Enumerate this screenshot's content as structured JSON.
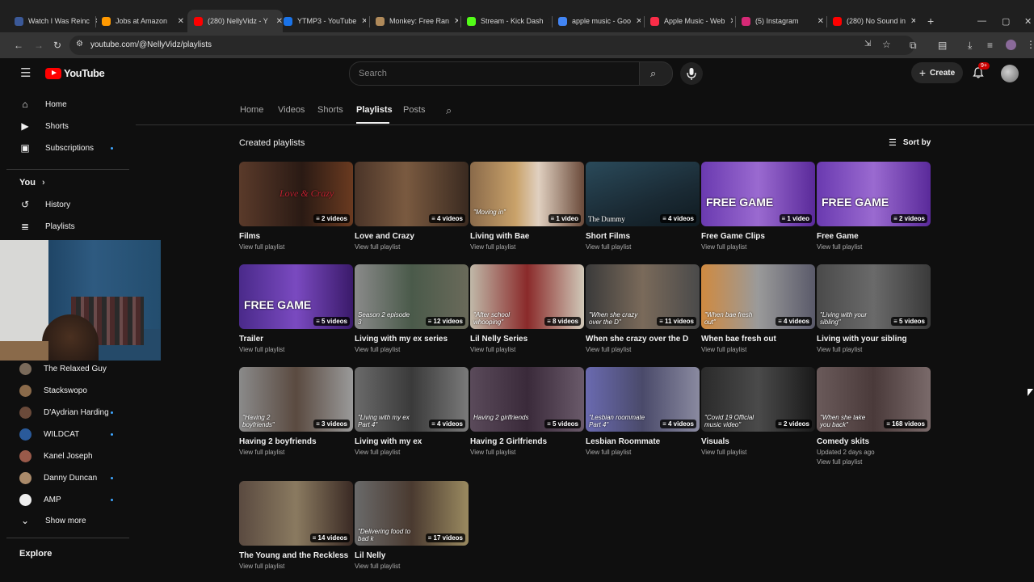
{
  "browser": {
    "tabs": [
      {
        "title": "Watch I Was Reinc",
        "color": "#3b5998"
      },
      {
        "title": "Jobs at Amazon",
        "color": "#ff9900"
      },
      {
        "title": "(280) NellyVidz - Y",
        "color": "#ff0000"
      },
      {
        "title": "YTMP3 - YouTube",
        "color": "#1a73e8"
      },
      {
        "title": "Monkey: Free Ran",
        "color": "#b08a5a"
      },
      {
        "title": "Stream - Kick Dash",
        "color": "#53fc18"
      },
      {
        "title": "apple music - Goo",
        "color": "#4285f4"
      },
      {
        "title": "Apple Music - Web",
        "color": "#fa2d48"
      },
      {
        "title": "(5) Instagram",
        "color": "#d62976"
      },
      {
        "title": "(280) No Sound in",
        "color": "#ff0000"
      }
    ],
    "url": "youtube.com/@NellyVidz/playlists",
    "new_tab": "+"
  },
  "header": {
    "logo_text": "YouTube",
    "search_placeholder": "Search",
    "create_label": "Create",
    "notif_badge": "9+"
  },
  "sidebar": {
    "main": [
      {
        "label": "Home",
        "icon": "home-icon"
      },
      {
        "label": "Shorts",
        "icon": "shorts-icon"
      },
      {
        "label": "Subscriptions",
        "icon": "subscriptions-icon"
      }
    ],
    "you_label": "You",
    "you_items": [
      {
        "label": "History",
        "icon": "history-icon"
      },
      {
        "label": "Playlists",
        "icon": "playlists-icon"
      }
    ],
    "subs": [
      {
        "label": "The Relaxed Guy",
        "color": "#7a6a5a"
      },
      {
        "label": "Stackswopo",
        "color": "#8a6a4a"
      },
      {
        "label": "D'Aydrian Harding",
        "color": "#6a4a3a"
      },
      {
        "label": "WILDCAT",
        "color": "#2a5a9a"
      },
      {
        "label": "Kanel Joseph",
        "color": "#9a5a4a"
      },
      {
        "label": "Danny Duncan",
        "color": "#aa8a6a"
      },
      {
        "label": "AMP",
        "color": "#eeeeee"
      }
    ],
    "show_more": "Show more",
    "explore": "Explore"
  },
  "channel_tabs": [
    "Home",
    "Videos",
    "Shorts",
    "Playlists",
    "Posts"
  ],
  "section_title": "Created playlists",
  "sort_label": "Sort by",
  "playlists": [
    {
      "title": "Films",
      "count": "2 videos",
      "link": "View full playlist",
      "bg": "linear-gradient(90deg,#5a3a2a,#2a1a14 55%,#6a3a20)",
      "caption": "Love & Crazy"
    },
    {
      "title": "Love and Crazy",
      "count": "4 videos",
      "link": "View full playlist",
      "bg": "linear-gradient(90deg,#4a3428,#7a5a40 45%,#3a2a20)",
      "caption": ""
    },
    {
      "title": "Living with Bae",
      "count": "1 video",
      "link": "View full playlist",
      "bg": "linear-gradient(90deg,#8a6a4a,#c9a26a 40%,#e0d0c0 60%,#6a4a3a)",
      "caption": "\"Moving in\""
    },
    {
      "title": "Short Films",
      "count": "4 videos",
      "link": "View full playlist",
      "bg": "linear-gradient(160deg,#2a4a5a,#1a2a34 60%,#0f1a20)",
      "caption": "The Dummy"
    },
    {
      "title": "Free Game Clips",
      "count": "1 video",
      "link": "View full playlist",
      "bg": "linear-gradient(90deg,#6a3ab0,#9a6ad0 50%,#5a2a9a)",
      "caption": "FREE GAME"
    },
    {
      "title": "Free Game",
      "count": "2 videos",
      "link": "View full playlist",
      "bg": "linear-gradient(90deg,#6a3ab0,#9a6ad0 50%,#5a2a9a)",
      "caption": "FREE GAME"
    },
    {
      "title": "Trailer",
      "count": "5 videos",
      "link": "View full playlist",
      "bg": "linear-gradient(90deg,#4a2a8a,#7a4ac0 50%,#3a1a6a)",
      "caption": "FREE GAME"
    },
    {
      "title": "Living with my ex series",
      "count": "12 videos",
      "link": "View full playlist",
      "bg": "linear-gradient(90deg,#8a8a8a,#4a5a4a 50%,#6a6a5a)",
      "caption": "Season 2 episode 3"
    },
    {
      "title": "Lil Nelly Series",
      "count": "8 videos",
      "link": "View full playlist",
      "bg": "linear-gradient(90deg,#c0b8a8,#8a2a2a 50%,#d0c8b8)",
      "caption": "\"After school whooping\""
    },
    {
      "title": "When she crazy over the D",
      "count": "11 videos",
      "link": "View full playlist",
      "bg": "linear-gradient(90deg,#3a3a3a,#7a6a5a 50%,#4a4a4a)",
      "caption": "\"When she crazy over the D\""
    },
    {
      "title": "When bae fresh out",
      "count": "4 videos",
      "link": "View full playlist",
      "bg": "linear-gradient(90deg,#d08a40,#9a9a9a 50%,#5a5a6a)",
      "caption": "\"When bae fresh out\""
    },
    {
      "title": "Living with your sibling",
      "count": "5 videos",
      "link": "View full playlist",
      "bg": "linear-gradient(90deg,#4a4a4a,#6a6a6a 50%,#3a3a3a)",
      "caption": "\"Living with your sibling\""
    },
    {
      "title": "Having 2 boyfriends",
      "count": "3 videos",
      "link": "View full playlist",
      "bg": "linear-gradient(90deg,#8a8a8a,#5a4a40 50%,#9a9a9a)",
      "caption": "\"Having 2 boyfriends\""
    },
    {
      "title": "Living with my ex",
      "count": "4 videos",
      "link": "View full playlist",
      "bg": "linear-gradient(90deg,#6a6a6a,#3a3a3a 50%,#7a7a7a)",
      "caption": "\"Living with my ex Part 4\""
    },
    {
      "title": "Having 2 Girlfriends",
      "count": "5 videos",
      "link": "View full playlist",
      "bg": "linear-gradient(90deg,#5a4a5a,#3a2a3a 50%,#6a5a6a)",
      "caption": "Having 2 girlfriends"
    },
    {
      "title": "Lesbian Roommate",
      "count": "4 videos",
      "link": "View full playlist",
      "bg": "linear-gradient(90deg,#6a6ab0,#4a4a6a 50%,#8a8aa0)",
      "caption": "\"Lesbian roommate Part 4\""
    },
    {
      "title": "Visuals",
      "count": "2 videos",
      "link": "View full playlist",
      "bg": "linear-gradient(90deg,#2a2a2a,#4a4a4a 50%,#1a1a1a)",
      "caption": "\"Covid 19 Official music video\""
    },
    {
      "title": "Comedy skits",
      "count": "168 videos",
      "meta": "Updated 2 days ago",
      "link": "View full playlist",
      "bg": "linear-gradient(90deg,#6a5a5a,#4a3a3a 50%,#7a6a6a)",
      "caption": "\"When she take you back\""
    },
    {
      "title": "The Young and the Reckless",
      "count": "14 videos",
      "link": "View full playlist",
      "bg": "linear-gradient(90deg,#5a4a40,#8a7a60 50%,#3a2a24)",
      "caption": ""
    },
    {
      "title": "Lil Nelly",
      "count": "17 videos",
      "link": "View full playlist",
      "bg": "linear-gradient(90deg,#6a6a6a,#4a3a30 50%,#9a8a60)",
      "caption": "\"Delivering food to bad k"
    }
  ]
}
